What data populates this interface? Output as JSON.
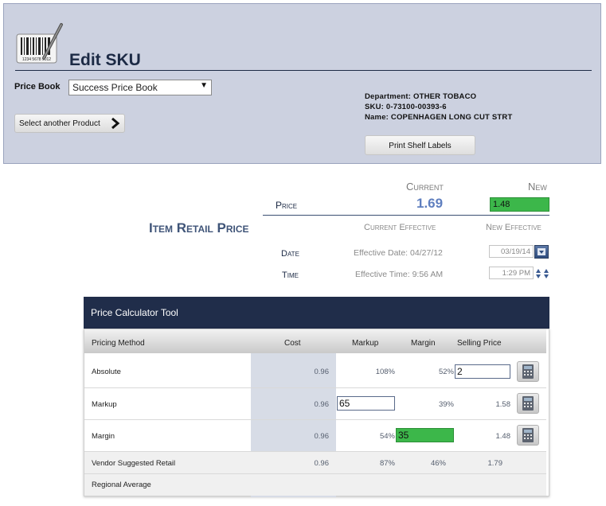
{
  "header": {
    "title": "Edit SKU",
    "barcode_digits": "1234 5678 9012",
    "price_book_label": "Price Book",
    "price_book_value": "Success Price Book",
    "another_product_label": "Select another Product",
    "department_line": "Department: OTHER TOBACO",
    "sku_line": "SKU: 0-73100-00393-6",
    "name_line": "Name: COPENHAGEN LONG CUT STRT",
    "print_labels_button": "Print Shelf Labels"
  },
  "pricing": {
    "current_header": "Current",
    "new_header": "New",
    "price_label": "Price",
    "current_price": "1.69",
    "new_price": "1.48",
    "section_title": "Item Retail Price",
    "current_effective_header": "Current Effective",
    "new_effective_header": "New Effective",
    "date_label": "Date",
    "time_label": "Time",
    "effective_date": "Effective Date: 04/27/12",
    "effective_time": "Effective Time: 9:56 AM",
    "new_date": "03/19/14",
    "new_time": "1:29 PM"
  },
  "calculator": {
    "title": "Price Calculator Tool",
    "columns": {
      "method": "Pricing Method",
      "cost": "Cost",
      "markup": "Markup",
      "margin": "Margin",
      "selling_price": "Selling Price"
    },
    "rows": [
      {
        "method": "Absolute",
        "cost": "0.96",
        "markup": "108%",
        "margin": "52%",
        "selling_price_input": "2"
      },
      {
        "method": "Markup",
        "cost": "0.96",
        "markup_input": "65",
        "margin": "39%",
        "selling_price": "1.58"
      },
      {
        "method": "Margin",
        "cost": "0.96",
        "markup": "54%",
        "margin_input": "35",
        "selling_price": "1.48"
      },
      {
        "method": "Vendor Suggested Retail",
        "cost": "0.96",
        "markup": "87%",
        "margin": "46%",
        "selling_price": "1.79"
      },
      {
        "method": "Regional Average"
      }
    ]
  },
  "colors": {
    "header_panel": "#ccd1e0",
    "navy": "#202d4a",
    "accent_green": "#3cb74a",
    "current_price_blue": "#5f7fbf"
  },
  "icons": {
    "barcode": "barcode-scanner-icon",
    "chevron": "chevron-right-icon",
    "calendar": "calendar-icon",
    "spinner": "time-spinner-icon",
    "calculator": "calculator-icon"
  }
}
